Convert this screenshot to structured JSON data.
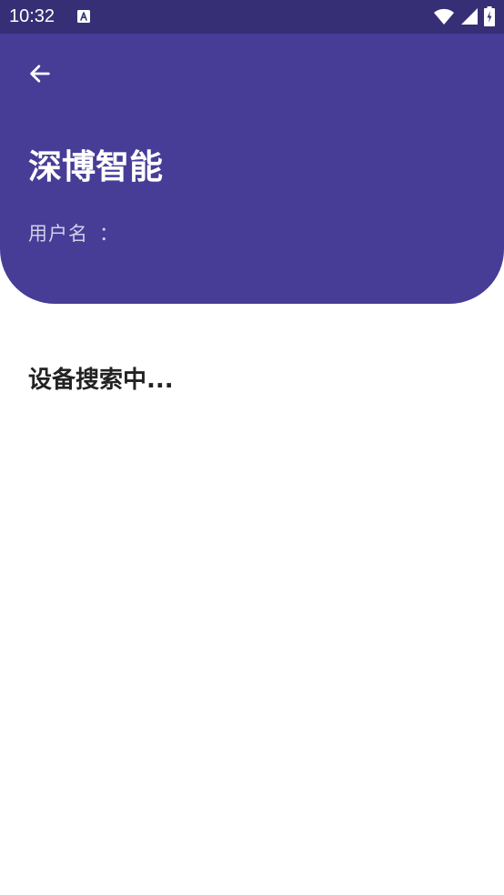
{
  "status_bar": {
    "time": "10:32",
    "notification_icon": "a-text-icon",
    "icons": [
      "wifi-icon",
      "cell-signal-icon",
      "battery-charging-icon"
    ]
  },
  "header": {
    "back_icon": "arrow-left-icon",
    "title": "深博智能",
    "username_label": "用户名",
    "username_separator": "：",
    "username_value": ""
  },
  "content": {
    "search_status": "设备搜索中..."
  },
  "colors": {
    "status_bar": "#372f75",
    "header": "#473d97",
    "title_text": "#ffffff",
    "muted_text": "#d2cfe9",
    "body_text": "#222222",
    "background": "#ffffff"
  }
}
